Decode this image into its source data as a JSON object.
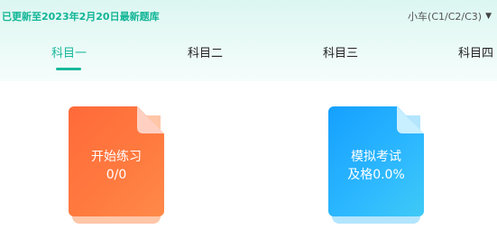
{
  "header": {
    "update_notice": "已更新至2023年2月20日最新题库",
    "license_type": "小车(C1/C2/C3)",
    "license_icon": "caret-down-icon"
  },
  "tabs": [
    {
      "label": "科目一",
      "active": true
    },
    {
      "label": "科目二",
      "active": false
    },
    {
      "label": "科目三",
      "active": false
    },
    {
      "label": "科目四",
      "active": false
    }
  ],
  "cards": {
    "practice": {
      "title": "开始练习",
      "value": "0/0",
      "color": "#ff6a3a"
    },
    "exam": {
      "title": "模拟考试",
      "value": "及格0.0%",
      "color": "#15a0ff"
    }
  },
  "colors": {
    "accent": "#19b89a"
  }
}
